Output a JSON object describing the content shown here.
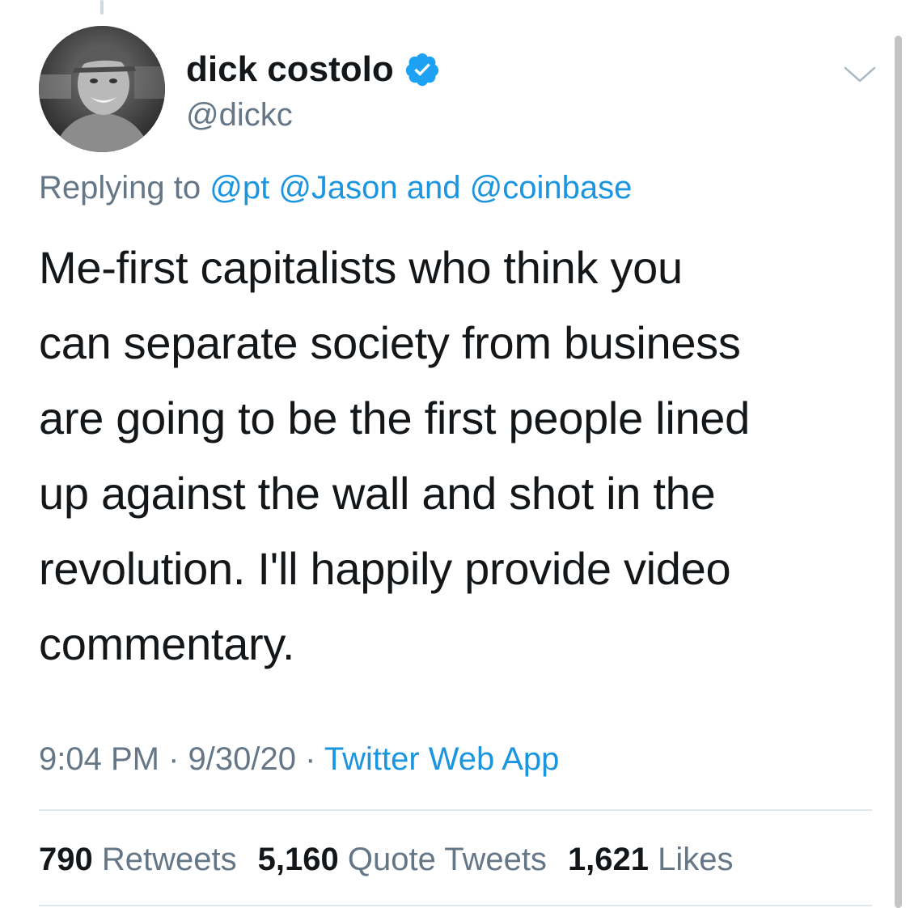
{
  "tweet": {
    "author": {
      "display_name": "dick costolo",
      "handle": "@dickc",
      "verified": true
    },
    "reply_prefix": "Replying to ",
    "reply_mentions": [
      "@pt",
      "@Jason"
    ],
    "reply_and": " and ",
    "reply_last_mention": "@coinbase",
    "text_lines": [
      "Me-first capitalists who think you",
      "can separate society from business",
      "are going to be the first people lined",
      "up against the wall and shot in the",
      "revolution. I'll happily provide video",
      "commentary."
    ],
    "time": "9:04 PM",
    "date": "9/30/20",
    "separator": "·",
    "source": "Twitter Web App",
    "stats": {
      "retweets": {
        "count": "790",
        "label": "Retweets"
      },
      "quote_tweets": {
        "count": "5,160",
        "label": "Quote Tweets"
      },
      "likes": {
        "count": "1,621",
        "label": "Likes"
      }
    }
  },
  "icons": {
    "verified": "verified-badge-icon",
    "more": "chevron-down-icon"
  },
  "colors": {
    "link": "#1b95e0",
    "secondary_text": "#657786",
    "primary_text": "#14171a",
    "verified": "#1da1f2",
    "divider": "#e1e8ed"
  }
}
